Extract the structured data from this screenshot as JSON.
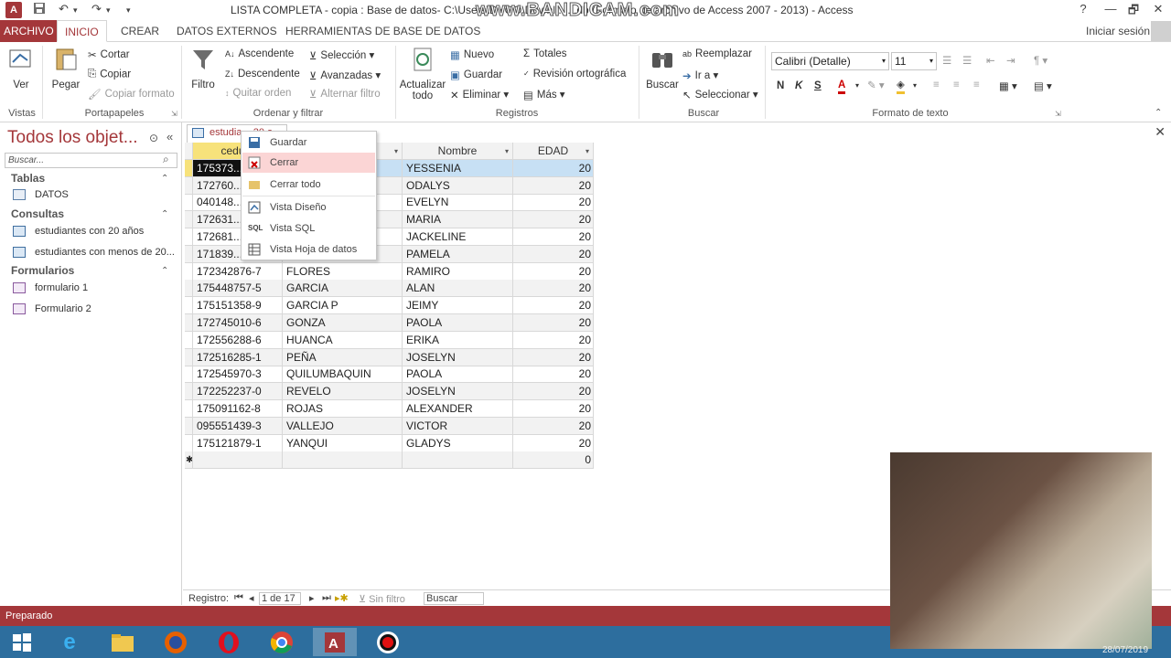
{
  "window": {
    "title": "LISTA COMPLETA - copia : Base de datos- C:\\Users\\DYGO\\Downl...                    ...db (Formato de archivo de Access 2007 - 2013) - Access",
    "watermark": "www.BANDICAM.com",
    "help_btn": "?",
    "restore_btn": "🗗",
    "min_btn": "—",
    "close_btn": "✕",
    "app_badge": "A"
  },
  "tabs": {
    "archivo": "ARCHIVO",
    "inicio": "INICIO",
    "crear": "CREAR",
    "datos_externos": "DATOS EXTERNOS",
    "herramientas": "HERRAMIENTAS DE BASE DE DATOS",
    "signin": "Iniciar sesión"
  },
  "ribbon": {
    "vistas": {
      "ver": "Ver",
      "label": "Vistas"
    },
    "portapapeles": {
      "pegar": "Pegar",
      "cortar": "Cortar",
      "copiar": "Copiar",
      "copiar_formato": "Copiar formato",
      "label": "Portapapeles"
    },
    "ordenar": {
      "filtro": "Filtro",
      "ascendente": "Ascendente",
      "descendente": "Descendente",
      "quitar_orden": "Quitar orden",
      "seleccion": "Selección",
      "avanzadas": "Avanzadas",
      "alternar": "Alternar filtro",
      "label": "Ordenar y filtrar"
    },
    "registros": {
      "actualizar1": "Actualizar",
      "actualizar2": "todo",
      "nuevo": "Nuevo",
      "guardar": "Guardar",
      "eliminar": "Eliminar",
      "totales": "Totales",
      "revision": "Revisión ortográfica",
      "mas": "Más",
      "label": "Registros"
    },
    "buscar": {
      "buscar": "Buscar",
      "reemplazar": "Reemplazar",
      "ira": "Ir a",
      "seleccionar": "Seleccionar",
      "label": "Buscar"
    },
    "formato": {
      "font": "Calibri (Detalle)",
      "size": "11",
      "bold": "N",
      "italic": "K",
      "underline": "S",
      "label": "Formato de texto"
    }
  },
  "nav": {
    "title": "Todos los objet...",
    "search_placeholder": "Buscar...",
    "tablas": "Tablas",
    "datos": "DATOS",
    "consultas": "Consultas",
    "q1": "estudiantes con 20 años",
    "q2": "estudiantes con menos de 20...",
    "formularios": "Formularios",
    "f1": "formulario 1",
    "f2": "Formulario 2"
  },
  "doc": {
    "tab_label": "estudia...  20 a...",
    "close": "✕"
  },
  "grid": {
    "headers": [
      "cedu...",
      "Apellido",
      "Nombre",
      "EDAD"
    ],
    "rows": [
      [
        "175373...",
        "",
        "YESSENIA",
        "20"
      ],
      [
        "172760...",
        "",
        "ODALYS",
        "20"
      ],
      [
        "040148...",
        "",
        "EVELYN",
        "20"
      ],
      [
        "172631...",
        "",
        "MARIA",
        "20"
      ],
      [
        "172681...",
        "",
        "JACKELINE",
        "20"
      ],
      [
        "171839...",
        "",
        "PAMELA",
        "20"
      ],
      [
        "172342876-7",
        "FLORES",
        "RAMIRO",
        "20"
      ],
      [
        "175448757-5",
        "GARCIA",
        "ALAN",
        "20"
      ],
      [
        "175151358-9",
        "GARCIA P",
        "JEIMY",
        "20"
      ],
      [
        "172745010-6",
        "GONZA",
        "PAOLA",
        "20"
      ],
      [
        "172556288-6",
        "HUANCA",
        "ERIKA",
        "20"
      ],
      [
        "172516285-1",
        "PEÑA",
        "JOSELYN",
        "20"
      ],
      [
        "172545970-3",
        "QUILUMBAQUIN",
        "PAOLA",
        "20"
      ],
      [
        "172252237-0",
        "REVELO",
        "JOSELYN",
        "20"
      ],
      [
        "175091162-8",
        "ROJAS",
        "ALEXANDER",
        "20"
      ],
      [
        "095551439-3",
        "VALLEJO",
        "VICTOR",
        "20"
      ],
      [
        "175121879-1",
        "YANQUI",
        "GLADYS",
        "20"
      ]
    ],
    "new_row_marker": "✱",
    "new_row_value": "0"
  },
  "context_menu": {
    "items": [
      "Guardar",
      "Cerrar",
      "Cerrar todo",
      "Vista Diseño",
      "Vista SQL",
      "Vista Hoja de datos"
    ]
  },
  "recnav": {
    "label": "Registro:",
    "position": "1 de 17",
    "filter": "Sin filtro",
    "search": "Buscar"
  },
  "status": {
    "text": "Preparado"
  },
  "clock": {
    "date": "28/07/2019"
  },
  "colors": {
    "accent": "#a4373a",
    "selection": "#c7e0f4",
    "menu_hover": "#fbd5d5"
  }
}
